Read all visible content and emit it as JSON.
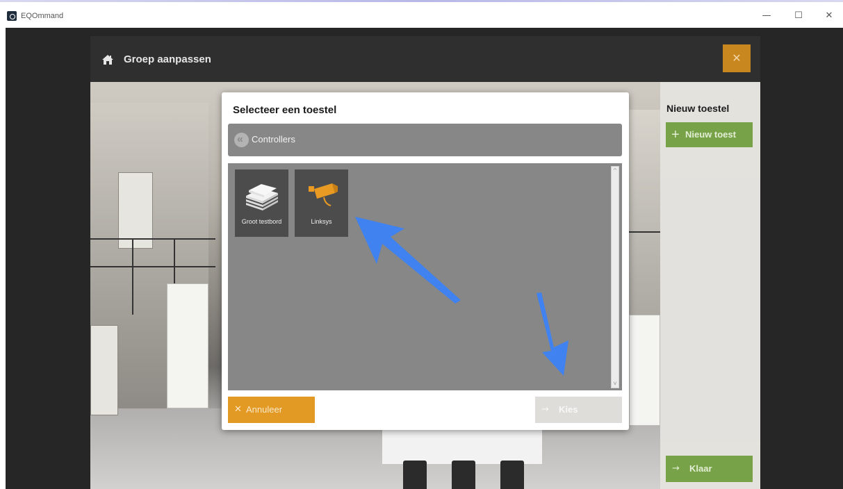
{
  "window": {
    "title": "EQOmmand",
    "controls": {
      "minimize": "—",
      "maximize": "☐",
      "close": "✕"
    }
  },
  "header": {
    "title": "Groep aanpassen",
    "icon": "home-icon",
    "close_icon": "✕",
    "close_color": "#c9871f"
  },
  "side_panel": {
    "title": "Nieuw toestel",
    "new_device_button": "Nieuw toest",
    "new_device_plus": "+",
    "done_button": "Klaar",
    "done_arrow": "→",
    "button_color": "#79a548"
  },
  "modal": {
    "title": "Selecteer een toestel",
    "breadcrumb": "Controllers",
    "devices": [
      {
        "label": "Groot testbord",
        "icon": "stacked-boards-icon"
      },
      {
        "label": "Linksys",
        "icon": "camera-icon"
      }
    ],
    "cancel_button": "Annuleer",
    "cancel_icon": "✕",
    "choose_button": "Kies",
    "choose_arrow": "→",
    "scroll_up": "^",
    "scroll_down": "v",
    "colors": {
      "cancel": "#e39a24",
      "choose_disabled": "#deddd9",
      "panel": "#878787",
      "tile": "#4c4c4c"
    }
  },
  "annotations": {
    "arrow_color": "#3b82f6"
  }
}
